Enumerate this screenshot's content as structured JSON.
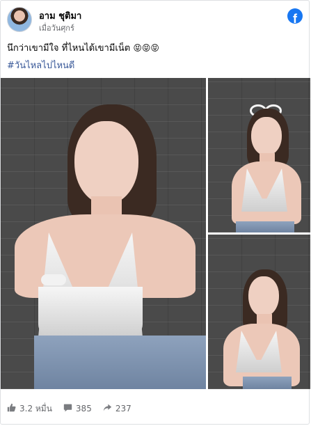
{
  "post": {
    "author_name": "อาม ชุติมา",
    "timestamp": "เมื่อวันศุกร์",
    "caption": "นึกว่าเขามีใจ ที่ไหนได้เขามีเน็ต",
    "caption_emojis": "😝😝😝",
    "hashtag": "#วันไหลไปไหนดี"
  },
  "icons": {
    "brand": "facebook-icon",
    "like": "like-icon",
    "comment": "comment-icon",
    "share": "share-icon"
  },
  "stats": {
    "likes": "3.2 หมื่น",
    "comments": "385",
    "shares": "237"
  },
  "colors": {
    "facebook_blue": "#1877f2",
    "hashtag": "#385898",
    "meta_text": "#65676b"
  }
}
